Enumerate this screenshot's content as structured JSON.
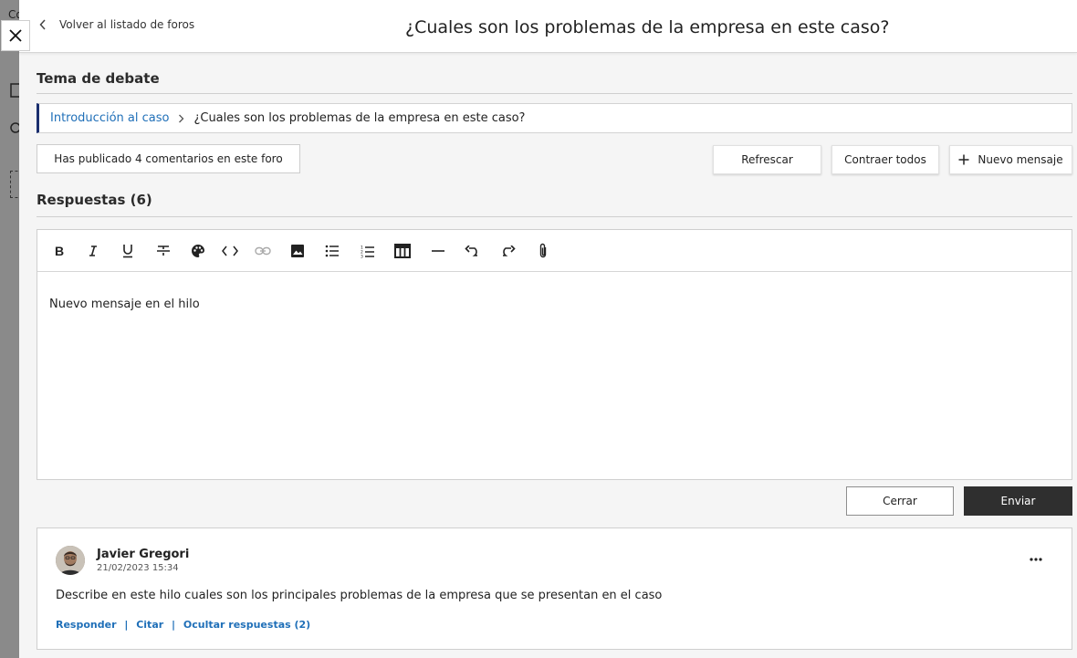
{
  "background": {
    "fragment": "Co"
  },
  "header": {
    "back_label": "Volver al listado de foros",
    "title": "¿Cuales son los problemas de la empresa en este caso?"
  },
  "topic": {
    "heading": "Tema de debate",
    "breadcrumb": {
      "parent": "Introducción al caso",
      "current": "¿Cuales son los problemas de la empresa en este caso?"
    }
  },
  "stats": {
    "comments_label": "Has publicado 4 comentarios en este foro"
  },
  "toolbar_actions": {
    "refresh": "Refrescar",
    "collapse_all": "Contraer todos",
    "new_message": "Nuevo mensaje"
  },
  "replies": {
    "heading": "Respuestas (6)"
  },
  "editor": {
    "content": "Nuevo mensaje en el hilo",
    "tools": [
      "bold-icon",
      "italic-icon",
      "underline-icon",
      "strikethrough-icon",
      "palette-icon",
      "code-icon",
      "link-icon",
      "image-icon",
      "bullet-list-icon",
      "numbered-list-icon",
      "table-icon",
      "horizontal-rule-icon",
      "undo-icon",
      "redo-icon",
      "attach-icon"
    ],
    "cancel_label": "Cerrar",
    "submit_label": "Enviar"
  },
  "post": {
    "author": "Javier Gregori",
    "date": "21/02/2023 15:34",
    "body": "Describe en este hilo cuales son los principales problemas de la empresa que se presentan en el caso",
    "actions": [
      "Responder",
      "Citar",
      "Ocultar respuestas (2)"
    ],
    "separator": "|"
  },
  "colors": {
    "link": "#1f6fb8",
    "breadcrumb_accent": "#1a2e6e",
    "primary_button": "#2f2f2f"
  }
}
